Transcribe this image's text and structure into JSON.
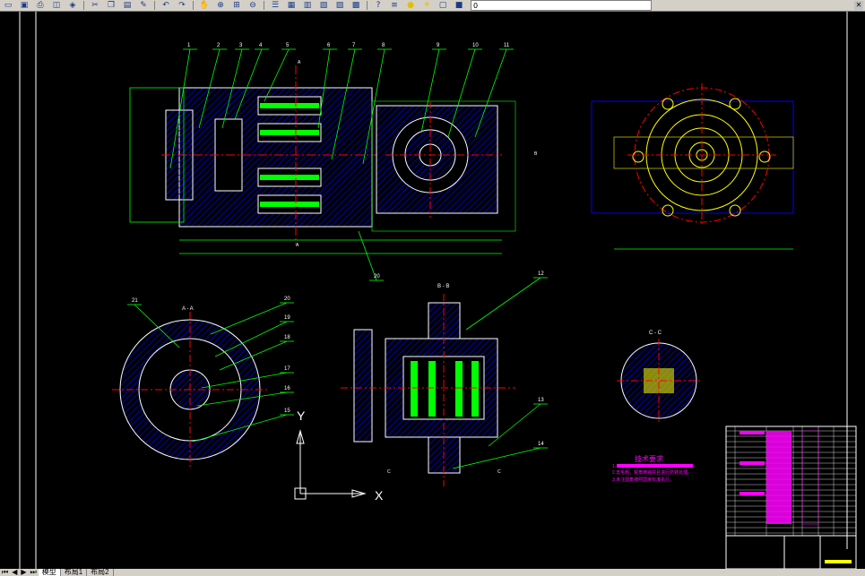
{
  "toolbar": {
    "icons": [
      "new-icon",
      "save-icon",
      "print-icon",
      "preview-icon",
      "publish-icon",
      "cut-icon",
      "copy-icon",
      "paste-icon",
      "matchprop-icon",
      "undo-icon",
      "redo-icon",
      "pan-icon",
      "zoom-realtime-icon",
      "zoom-window-icon",
      "zoom-previous-icon",
      "properties-icon",
      "designcenter-icon",
      "toolpalette-icon",
      "sheetset-icon",
      "markup-icon",
      "calc-icon",
      "help-icon",
      "layer-icon",
      "bulb-icon",
      "sun-icon",
      "lock-icon",
      "color-icon"
    ],
    "layer_value": "0"
  },
  "tabs": {
    "nav": [
      "⏮",
      "◀",
      "▶",
      "⏭"
    ],
    "items": [
      "模型",
      "布局1",
      "布局2"
    ],
    "active": 0
  },
  "drawing": {
    "callouts_top": [
      "1",
      "2",
      "3",
      "4",
      "5",
      "6",
      "7",
      "8",
      "9",
      "10",
      "11"
    ],
    "callout_12": "12",
    "callout_13": "13",
    "callout_14": "14",
    "callout_20_top": "20",
    "callouts_aa": [
      "21",
      "20",
      "19",
      "18",
      "17",
      "16",
      "15"
    ],
    "section_aa": "A - A",
    "section_bb": "B - B",
    "section_cc": "C - C",
    "marker_a": "A",
    "marker_b": "B",
    "marker_c": "C",
    "axis_x": "X",
    "axis_y": "Y",
    "tech_title": "技术要求",
    "tech_lines": [
      "1.",
      "2.去毛刺，锐角倒钝并且进行防锈处理。",
      "3.未注圆角按照国家标准执行。"
    ]
  },
  "colors": {
    "background": "#000000",
    "contour": "#ffffff",
    "hatch": "#0000ff",
    "center": "#ff0000",
    "leader": "#00ff00",
    "dim": "#00ff00",
    "dim_alt": "#ffff00",
    "cyan": "#00ffff",
    "magenta": "#ff00ff"
  }
}
